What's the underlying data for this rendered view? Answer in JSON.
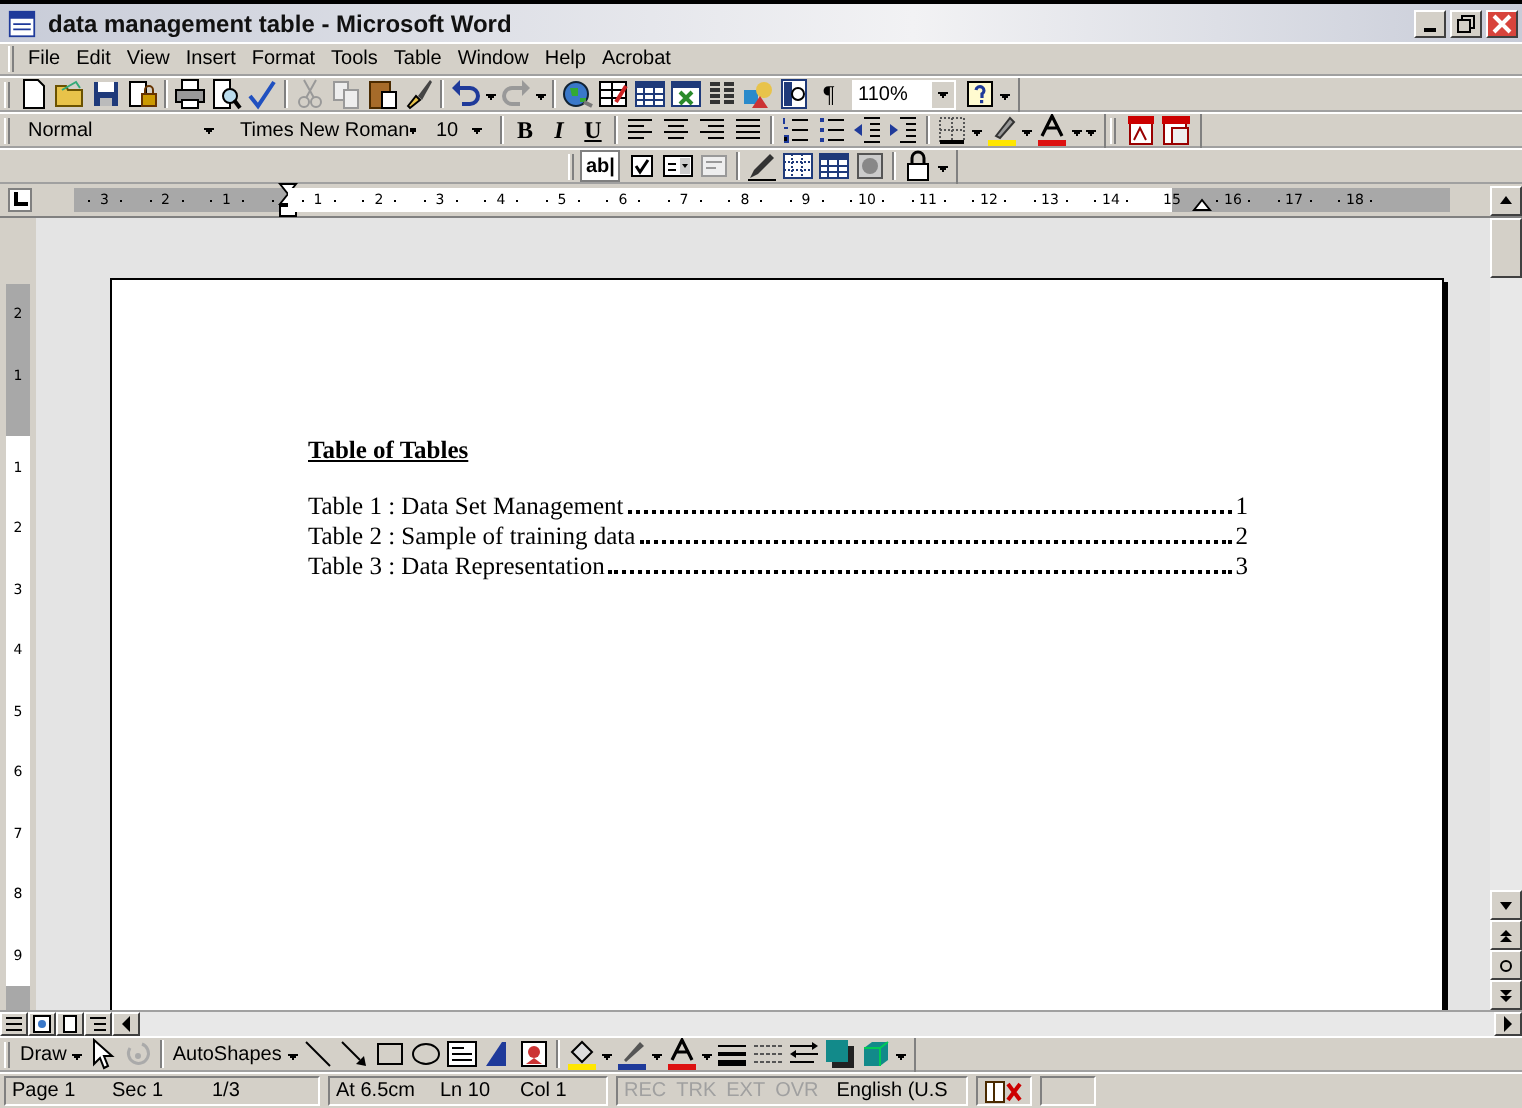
{
  "window": {
    "title": "data management table - Microsoft Word"
  },
  "menu": [
    {
      "label": "File"
    },
    {
      "label": "Edit"
    },
    {
      "label": "View"
    },
    {
      "label": "Insert"
    },
    {
      "label": "Format"
    },
    {
      "label": "Tools"
    },
    {
      "label": "Table"
    },
    {
      "label": "Window"
    },
    {
      "label": "Help"
    },
    {
      "label": "Acrobat"
    }
  ],
  "standard_toolbar": {
    "show_formatting": "¶",
    "zoom": "110%"
  },
  "formatting_toolbar": {
    "style": "Normal",
    "font": "Times New Roman",
    "size": "10",
    "bold": "B",
    "italic": "I",
    "underline": "U"
  },
  "forms_toolbar": {
    "text_field": "ab|"
  },
  "ruler": {
    "marks": [
      {
        "label": "3",
        "margin": true
      },
      {
        "label": "2",
        "margin": true
      },
      {
        "label": "1",
        "margin": true
      },
      {
        "label": "1",
        "margin": false
      },
      {
        "label": "2",
        "margin": false
      },
      {
        "label": "3",
        "margin": false
      },
      {
        "label": "4",
        "margin": false
      },
      {
        "label": "5",
        "margin": false
      },
      {
        "label": "6",
        "margin": false
      },
      {
        "label": "7",
        "margin": false
      },
      {
        "label": "8",
        "margin": false
      },
      {
        "label": "9",
        "margin": false
      },
      {
        "label": "10",
        "margin": false
      },
      {
        "label": "11",
        "margin": false
      },
      {
        "label": "12",
        "margin": false
      },
      {
        "label": "13",
        "margin": false
      },
      {
        "label": "14",
        "margin": false
      },
      {
        "label": "15",
        "margin": false
      },
      {
        "label": "16",
        "margin": true
      },
      {
        "label": "17",
        "margin": true
      },
      {
        "label": "18",
        "margin": true
      }
    ]
  },
  "vertical_ruler": {
    "marks": [
      {
        "label": "2",
        "margin": true
      },
      {
        "label": "1",
        "margin": true
      },
      {
        "label": "1",
        "margin": false
      },
      {
        "label": "2",
        "margin": false
      },
      {
        "label": "3",
        "margin": false
      },
      {
        "label": "4",
        "margin": false
      },
      {
        "label": "5",
        "margin": false
      },
      {
        "label": "6",
        "margin": false
      },
      {
        "label": "7",
        "margin": false
      },
      {
        "label": "8",
        "margin": false
      },
      {
        "label": "9",
        "margin": false
      }
    ]
  },
  "document": {
    "heading": "Table of Tables",
    "entries": [
      {
        "caption": "Table 1 : Data Set Management",
        "page": "1"
      },
      {
        "caption": "Table 2 : Sample of training data",
        "page": "2"
      },
      {
        "caption": "Table 3 : Data Representation",
        "page": "3"
      }
    ]
  },
  "drawing_toolbar": {
    "draw": {
      "label": "Draw"
    },
    "autoshapes": {
      "label": "AutoShapes"
    }
  },
  "status_bar": {
    "position": [
      "Page 1",
      "Sec 1",
      "1/3"
    ],
    "location": [
      "At 6.5cm",
      "Ln 10",
      "Col 1"
    ],
    "modes": [
      {
        "text": "REC",
        "disabled": true
      },
      {
        "text": "TRK",
        "disabled": true
      },
      {
        "text": "EXT",
        "disabled": true
      },
      {
        "text": "OVR",
        "disabled": true
      }
    ],
    "language": "English (U.S"
  }
}
